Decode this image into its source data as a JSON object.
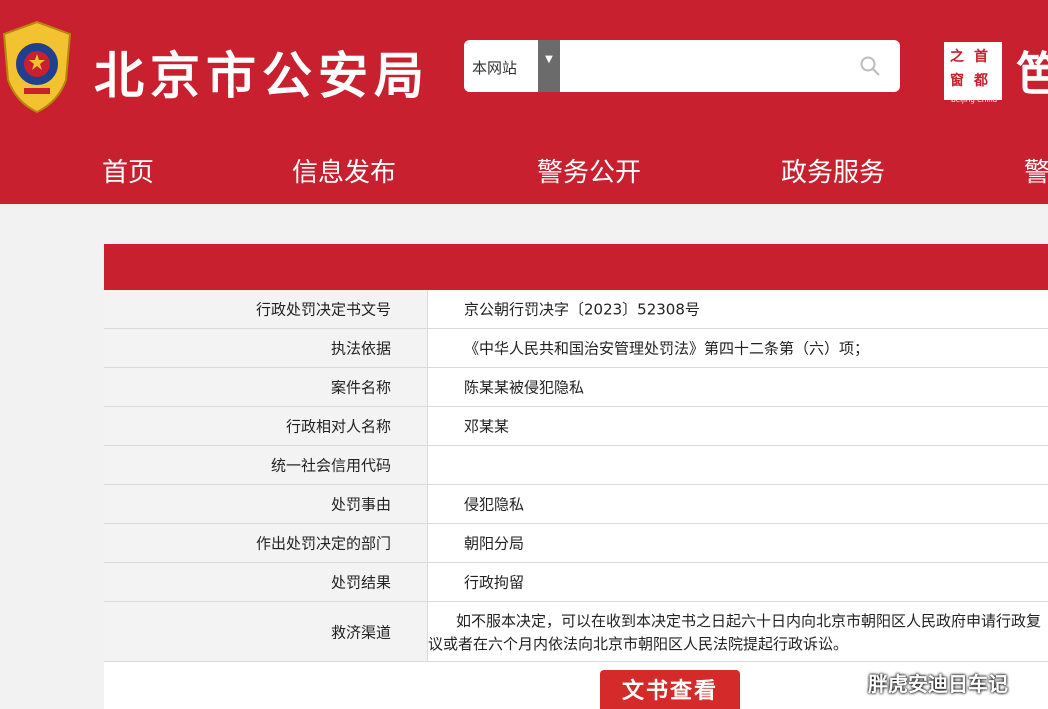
{
  "header": {
    "site_title": "北京市公安局",
    "search": {
      "scope": "本网站",
      "placeholder": ""
    },
    "logo2_chars": [
      "之",
      "首",
      "窗",
      "都"
    ],
    "logo2_sub": "Beijing·China",
    "logo3_char": "笆"
  },
  "nav": [
    {
      "label": "首页"
    },
    {
      "label": "信息发布"
    },
    {
      "label": "警务公开"
    },
    {
      "label": "政务服务"
    },
    {
      "label": "警"
    }
  ],
  "table": {
    "rows": [
      {
        "label": "行政处罚决定书文号",
        "value": "京公朝行罚决字〔2023〕52308号"
      },
      {
        "label": "执法依据",
        "value": "《中华人民共和国治安管理处罚法》第四十二条第（六）项；"
      },
      {
        "label": "案件名称",
        "value": "陈某某被侵犯隐私"
      },
      {
        "label": "行政相对人名称",
        "value": "邓某某"
      },
      {
        "label": "统一社会信用代码",
        "value": ""
      },
      {
        "label": "处罚事由",
        "value": "侵犯隐私"
      },
      {
        "label": "作出处罚决定的部门",
        "value": "朝阳分局"
      },
      {
        "label": "处罚结果",
        "value": "行政拘留"
      },
      {
        "label": "救济渠道",
        "value": "如不服本决定，可以在收到本决定书之日起六十日内向北京市朝阳区人民政府申请行政复议或者在六个月内依法向北京市朝阳区人民法院提起行政诉讼。"
      }
    ]
  },
  "doc_button_label": "文书查看",
  "watermark": "胖虎安迪日车记",
  "colors": {
    "brand_red": "#c8202e",
    "button_red": "#d42a2a"
  }
}
